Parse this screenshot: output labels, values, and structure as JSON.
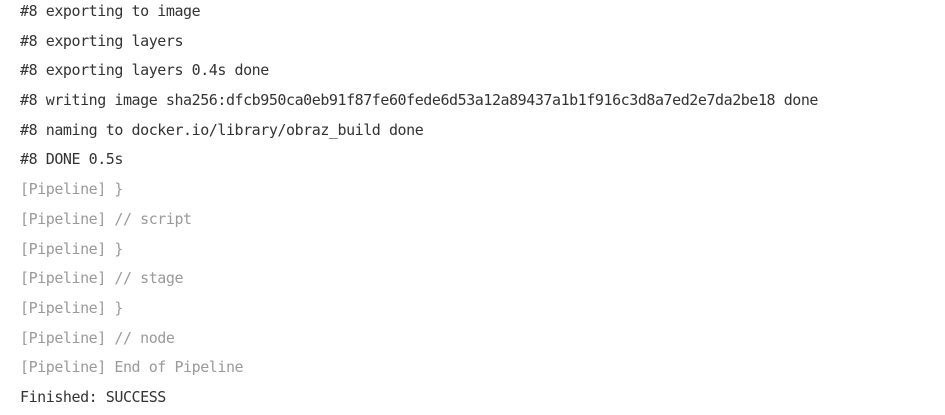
{
  "console": {
    "lines": [
      {
        "text": "#8 exporting to image",
        "kind": "output"
      },
      {
        "text": "#8 exporting layers",
        "kind": "output"
      },
      {
        "text": "#8 exporting layers 0.4s done",
        "kind": "output"
      },
      {
        "text": "#8 writing image sha256:dfcb950ca0eb91f87fe60fede6d53a12a89437a1b1f916c3d8a7ed2e7da2be18 done",
        "kind": "output"
      },
      {
        "text": "#8 naming to docker.io/library/obraz_build done",
        "kind": "output"
      },
      {
        "text": "#8 DONE 0.5s",
        "kind": "output"
      },
      {
        "text": "[Pipeline] }",
        "kind": "pipeline"
      },
      {
        "text": "[Pipeline] // script",
        "kind": "pipeline"
      },
      {
        "text": "[Pipeline] }",
        "kind": "pipeline"
      },
      {
        "text": "[Pipeline] // stage",
        "kind": "pipeline"
      },
      {
        "text": "[Pipeline] }",
        "kind": "pipeline"
      },
      {
        "text": "[Pipeline] // node",
        "kind": "pipeline"
      },
      {
        "text": "[Pipeline] End of Pipeline",
        "kind": "pipeline"
      },
      {
        "text": "Finished: SUCCESS",
        "kind": "output"
      }
    ]
  },
  "colors": {
    "background": "#ffffff",
    "output_text": "#333333",
    "pipeline_text": "#9a9a9a"
  }
}
